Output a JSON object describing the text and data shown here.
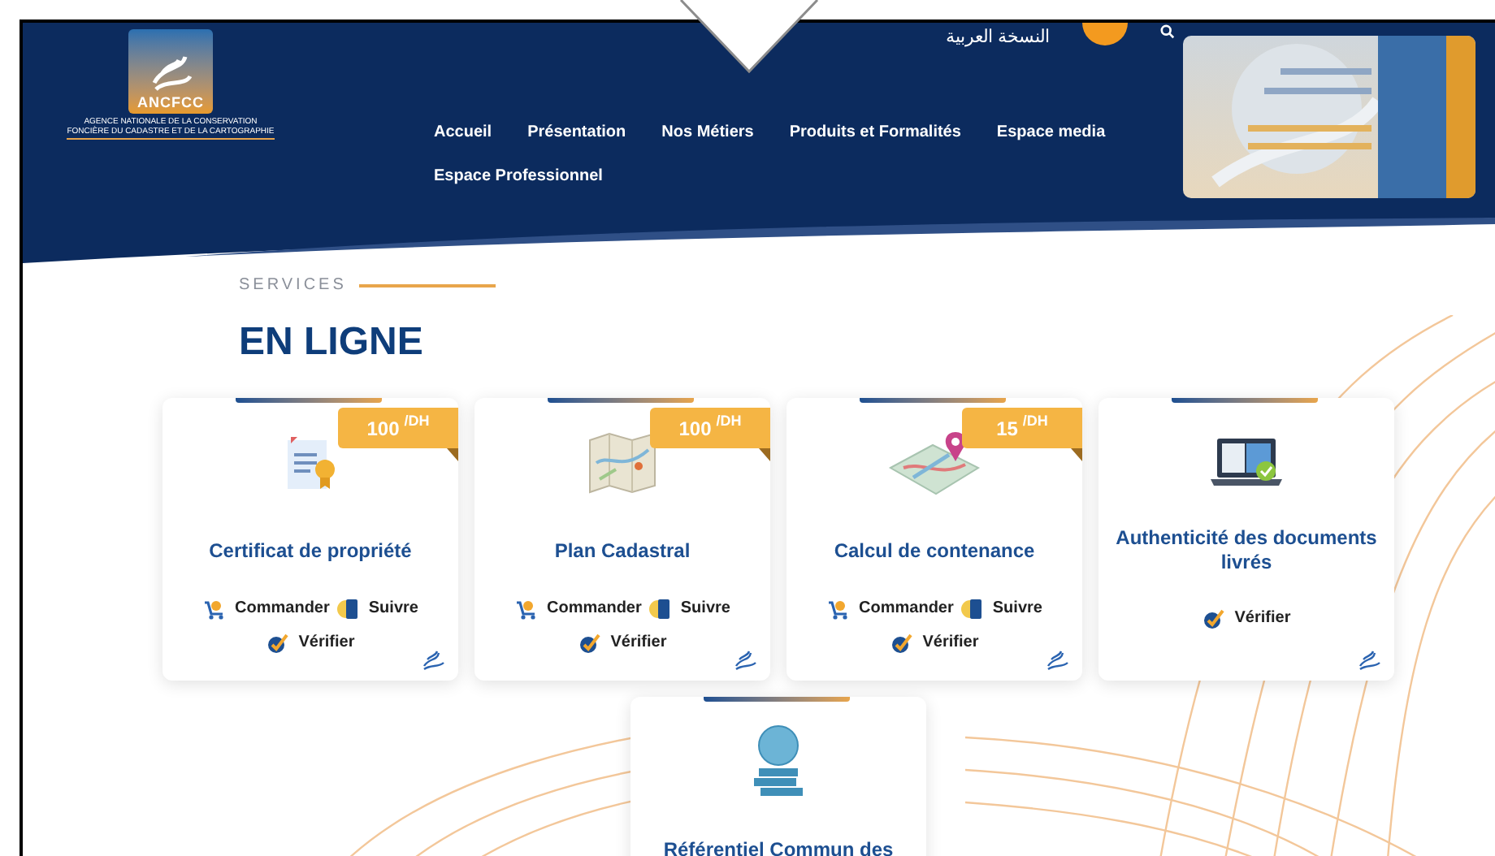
{
  "header": {
    "logo": {
      "acronym": "ANCFCC",
      "agency_lines": [
        "AGENCE NATIONALE DE LA CONSERVATION",
        "FONCIÈRE DU CADASTRE ET DE LA CARTOGRAPHIE"
      ]
    },
    "language_link": "النسخة العربية",
    "nav": [
      "Accueil",
      "Présentation",
      "Nos Métiers",
      "Produits et Formalités",
      "Espace media",
      "Espace Professionnel"
    ]
  },
  "section": {
    "eyebrow": "SERVICES",
    "title": "EN LIGNE"
  },
  "services": [
    {
      "kind": "certificate",
      "title": "Certificat de propriété",
      "price": "100 $^{/DH}$",
      "actions": [
        {
          "kind": "order",
          "label": "Commander"
        },
        {
          "kind": "track",
          "label": "Suivre"
        },
        {
          "kind": "verify",
          "label": "Vérifier"
        }
      ]
    },
    {
      "kind": "map",
      "title": "Plan Cadastral",
      "price": "100 $^{/DH}$",
      "actions": [
        {
          "kind": "order",
          "label": "Commander"
        },
        {
          "kind": "track",
          "label": "Suivre"
        },
        {
          "kind": "verify",
          "label": "Vérifier"
        }
      ]
    },
    {
      "kind": "location",
      "title": "Calcul de contenance",
      "price": "15 $^{/DH}$",
      "actions": [
        {
          "kind": "order",
          "label": "Commander"
        },
        {
          "kind": "track",
          "label": "Suivre"
        },
        {
          "kind": "verify",
          "label": "Vérifier"
        }
      ]
    },
    {
      "kind": "laptop",
      "title": "Authenticité des documents livrés",
      "actions": [
        {
          "kind": "verify",
          "label": "Vérifier"
        }
      ]
    },
    {
      "kind": "coins",
      "title": "Référentiel Commun des"
    }
  ]
}
